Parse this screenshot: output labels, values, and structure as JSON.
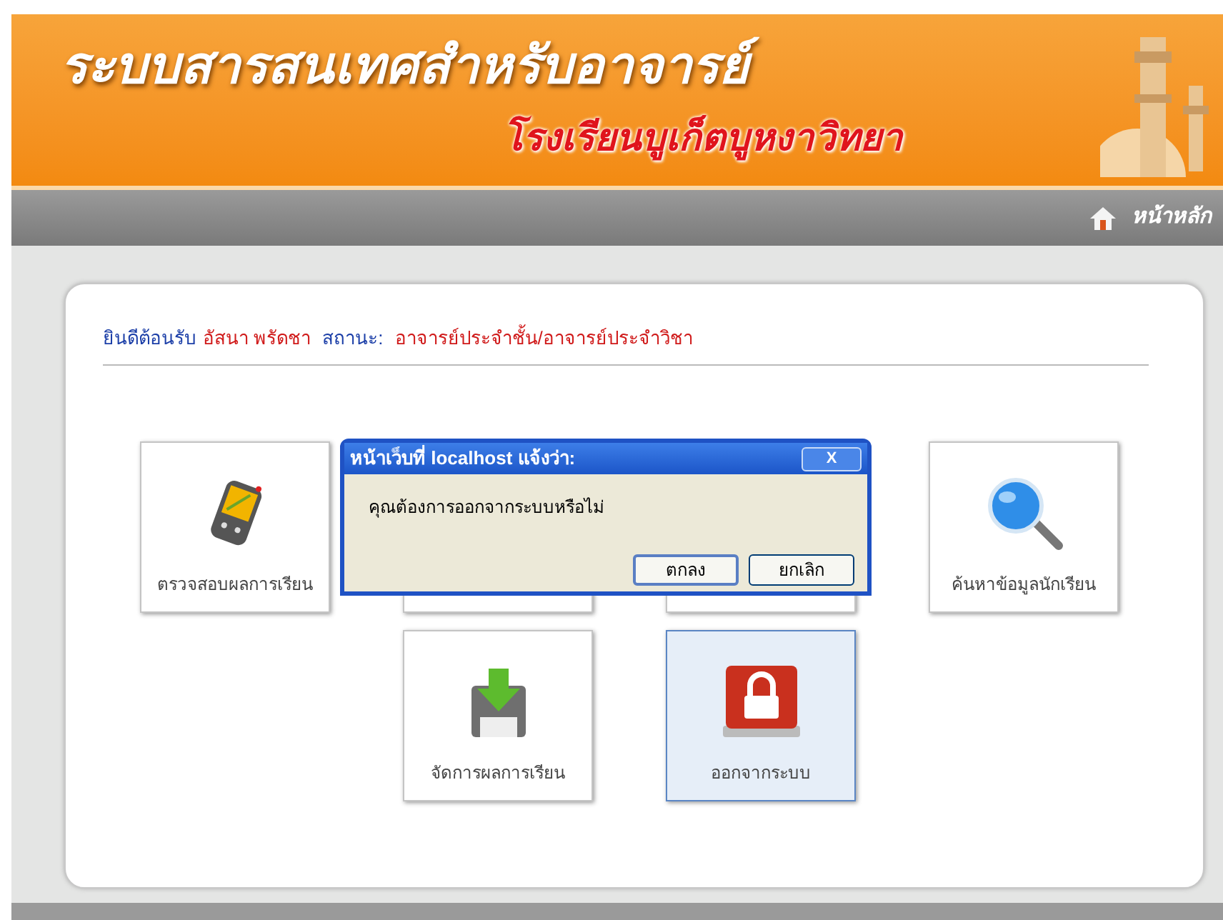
{
  "header": {
    "title": "ระบบสารสนเทศสำหรับอาจารย์",
    "subtitle": "โรงเรียนบูเก็ตบูหงาวิทยา"
  },
  "nav": {
    "home_link": "หน้าหลัก"
  },
  "welcome": {
    "greeting": "ยินดีต้อนรับ",
    "user_name": "อัสนา พรัดชา",
    "status_label": "สถานะ:",
    "status_value": "อาจารย์ประจำชั้น/อาจารย์ประจำวิชา"
  },
  "tiles": [
    {
      "label": "ตรวจสอบผลการเรียน",
      "kind": "handheld",
      "selected": false
    },
    {
      "kind": "covered",
      "selected": false
    },
    {
      "kind": "covered",
      "selected": false
    },
    {
      "label": "ค้นหาข้อมูลนักเรียน",
      "kind": "magnifier",
      "selected": false
    },
    {
      "label": "จัดการผลการเรียน",
      "kind": "download",
      "selected": false
    },
    {
      "label": "ออกจากระบบ",
      "kind": "lock",
      "selected": true
    }
  ],
  "dialog": {
    "title": "หน้าเว็บที่ localhost แจ้งว่า:",
    "message": "คุณต้องการออกจากระบบหรือไม่",
    "close": "X",
    "buttons": [
      {
        "label": "ตกลง",
        "default": true
      },
      {
        "label": "ยกเลิก",
        "default": false
      }
    ]
  }
}
